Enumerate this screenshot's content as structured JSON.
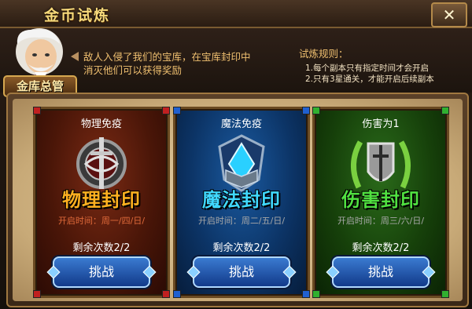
{
  "window": {
    "title": "金币试炼",
    "close_glyph": "✕"
  },
  "npc": {
    "role_label": "金库总管",
    "intro_line1": "敌人入侵了我们的宝库，在宝库封印中",
    "intro_line2": "消灭他们可以获得奖励"
  },
  "rules": {
    "title": "试炼规则：",
    "items": [
      "1.每个副本只有指定时间才会开启",
      "2.只有3星通关，才能开启后续副本"
    ]
  },
  "cards": [
    {
      "subtitle": "物理免疫",
      "seal_name": "物理封印",
      "open_time": "开启时间：周一/四/日/",
      "remaining": "剩余次数2/2",
      "button_label": "挑战",
      "seal_color": "#ffb020",
      "time_color": "#e06a3a",
      "icon": "sword-shield-icon"
    },
    {
      "subtitle": "魔法免疫",
      "seal_name": "魔法封印",
      "open_time": "开启时间：周二/五/日/",
      "remaining": "剩余次数2/2",
      "button_label": "挑战",
      "seal_color": "#40d8ff",
      "time_color": "#a8a8a8",
      "icon": "magic-book-icon"
    },
    {
      "subtitle": "伤害为1",
      "seal_name": "伤害封印",
      "open_time": "开启时间：周三/六/日/",
      "remaining": "剩余次数2/2",
      "button_label": "挑战",
      "seal_color": "#50e040",
      "time_color": "#a8a8a8",
      "icon": "laurel-shield-icon"
    }
  ]
}
